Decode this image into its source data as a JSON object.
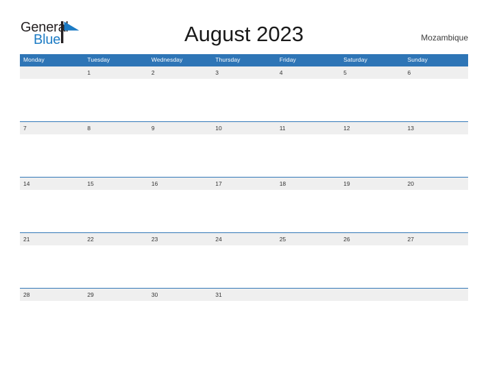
{
  "brand": {
    "name_part1": "General",
    "name_part2": "Blue",
    "flag_icon": "flag-icon",
    "pole_color": "#231f20",
    "flag_color": "#1c7bc4"
  },
  "header": {
    "title": "August 2023",
    "country": "Mozambique"
  },
  "colors": {
    "header_blue": "#2e75b6",
    "row_gray": "#efefef",
    "page_background": "#ffffff",
    "date_text": "#333333",
    "weekday_text": "#ffffff"
  },
  "calendar": {
    "weekdays": [
      "Monday",
      "Tuesday",
      "Wednesday",
      "Thursday",
      "Friday",
      "Saturday",
      "Sunday"
    ],
    "weeks": [
      [
        "",
        "1",
        "2",
        "3",
        "4",
        "5",
        "6"
      ],
      [
        "7",
        "8",
        "9",
        "10",
        "11",
        "12",
        "13"
      ],
      [
        "14",
        "15",
        "16",
        "17",
        "18",
        "19",
        "20"
      ],
      [
        "21",
        "22",
        "23",
        "24",
        "25",
        "26",
        "27"
      ],
      [
        "28",
        "29",
        "30",
        "31",
        "",
        "",
        ""
      ]
    ]
  }
}
